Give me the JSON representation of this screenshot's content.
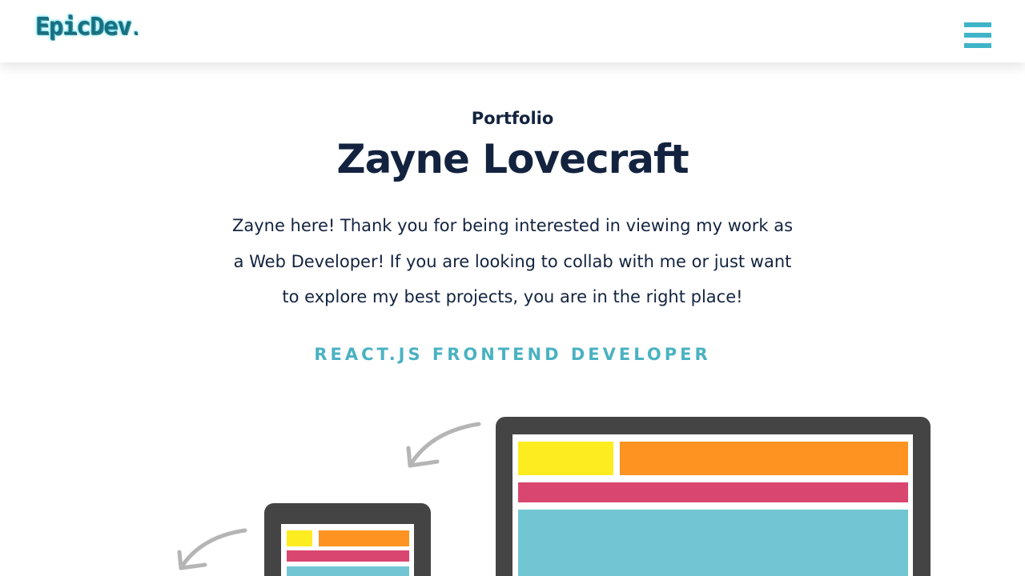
{
  "header": {
    "logo_text": "EpicDev",
    "logo_dot": ".",
    "menu_icon": "hamburger-menu-icon"
  },
  "hero": {
    "kicker": "Portfolio",
    "title": "Zayne Lovecraft",
    "description_lines": [
      "Zayne here! Thank you for being interested in viewing my work as",
      "a Web Developer! If you are looking to collab with me or just want",
      "to explore my best projects, you are in the right place!"
    ],
    "role": "REACT.JS FRONTEND DEVELOPER"
  },
  "colors": {
    "primary_text": "#13233f",
    "accent": "#4ab2c2",
    "menu": "#3fb3c7",
    "device_frame": "#444444",
    "block_yellow": "#fdec1f",
    "block_orange": "#ff9321",
    "block_pink": "#d94670",
    "block_cyan": "#72c6d3"
  }
}
